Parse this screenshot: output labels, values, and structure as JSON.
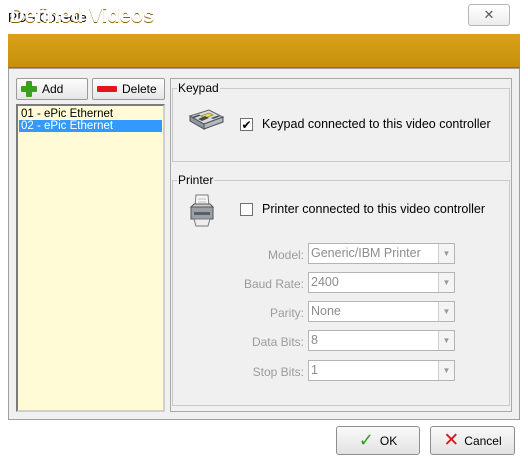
{
  "window": {
    "title": "RDS Console",
    "close_glyph": "✕"
  },
  "header": {
    "title": "Defined Videos"
  },
  "toolbar": {
    "add_label": "Add",
    "delete_label": "Delete"
  },
  "list": {
    "items": [
      {
        "label": "01 - ePic Ethernet",
        "selected": false
      },
      {
        "label": "02 - ePic Ethernet",
        "selected": true
      }
    ]
  },
  "keypad": {
    "group_label": "Keypad",
    "icon": "keypad-icon",
    "checkbox_label": "Keypad connected to this video controller",
    "checked": true
  },
  "printer": {
    "group_label": "Printer",
    "icon": "printer-icon",
    "checkbox_label": "Printer connected to this video controller",
    "checked": false,
    "fields": [
      {
        "label": "Model:",
        "value": "Generic/IBM Printer"
      },
      {
        "label": "Baud Rate:",
        "value": "2400"
      },
      {
        "label": "Parity:",
        "value": "None"
      },
      {
        "label": "Data Bits:",
        "value": "8"
      },
      {
        "label": "Stop Bits:",
        "value": "1"
      }
    ]
  },
  "buttons": {
    "ok_label": "OK",
    "cancel_label": "Cancel"
  },
  "colors": {
    "banner": "#c7900c",
    "selection": "#3399ff",
    "list_bg": "#fffbd6"
  }
}
